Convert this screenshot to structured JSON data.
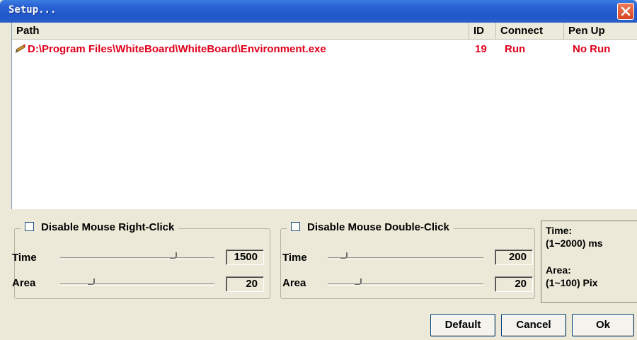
{
  "window": {
    "title": "Setup..."
  },
  "columns": {
    "path": "Path",
    "id": "ID",
    "connect": "Connect",
    "penup": "Pen Up"
  },
  "rows": [
    {
      "path": "D:\\Program Files\\WhiteBoard\\WhiteBoard\\Environment.exe",
      "id": "19",
      "connect": "Run",
      "penup": "No Run",
      "icon": "pen-icon"
    }
  ],
  "right_click": {
    "label": "Disable Mouse Right-Click",
    "checked": false,
    "time_label": "Time",
    "time_value": "1500",
    "area_label": "Area",
    "area_value": "20"
  },
  "double_click": {
    "label": "Disable Mouse Double-Click",
    "checked": false,
    "time_label": "Time",
    "time_value": "200",
    "area_label": "Area",
    "area_value": "20"
  },
  "info": {
    "time_label": "Time:",
    "time_range": "(1~2000) ms",
    "area_label": "Area:",
    "area_range": "(1~100) Pix"
  },
  "buttons": {
    "default": "Default",
    "cancel": "Cancel",
    "ok": "Ok"
  },
  "colors": {
    "title_bar": "#2a62d4",
    "row_text": "#e0001b",
    "dialog_bg": "#ece9d8"
  }
}
